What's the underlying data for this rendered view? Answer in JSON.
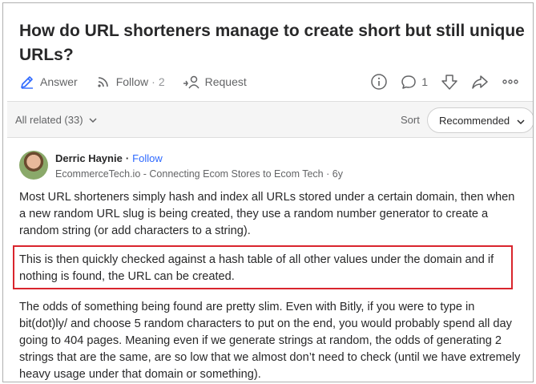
{
  "question": {
    "title": "How do URL shorteners manage to create short but still unique URLs?"
  },
  "actions": {
    "answer_label": "Answer",
    "follow_label": "Follow",
    "follow_separator": "·",
    "follow_count": "2",
    "request_label": "Request",
    "comment_count": "1"
  },
  "related": {
    "label": "All related (33)",
    "sort_label": "Sort",
    "sort_value": "Recommended"
  },
  "answer": {
    "author_name": "Derric Haynie",
    "separator": "·",
    "follow_label": "Follow",
    "credential": "EcommerceTech.io - Connecting Ecom Stores to Ecom Tech · 6y",
    "paragraphs": [
      "Most URL shorteners simply hash and index all URLs stored under a certain domain, then when a new random URL slug is being created, they use a random number generator to create a random string (or add characters to a string).",
      "This is then quickly checked against a hash table of all other values under the domain and if nothing is found, the URL can be created.",
      "The odds of something being found are pretty slim. Even with Bitly, if you were to type in bit(dot)ly/ and choose 5 random characters to put on the end, you would probably spend all day going to 404 pages. Meaning even if we generate strings at random, the odds of generating 2 strings that are the same, are so low that we almost don’t need to check (until we have extremely heavy usage under that domain or something)."
    ]
  },
  "colors": {
    "link_blue": "#2e69ff",
    "highlight_red": "#d9252d",
    "text_primary": "#282829",
    "text_secondary": "#636466"
  },
  "icons": [
    "pen-icon",
    "follow-signal-icon",
    "request-person-icon",
    "info-icon",
    "comment-icon",
    "downvote-icon",
    "share-icon",
    "more-icon",
    "chevron-down-icon"
  ]
}
